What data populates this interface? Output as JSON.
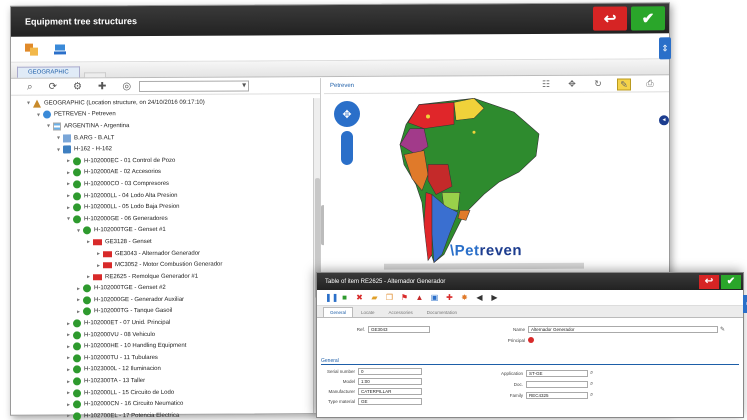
{
  "window": {
    "title": "Equipment tree structures",
    "back_glyph": "↩",
    "confirm_glyph": "✔"
  },
  "tabs": [
    "GEOGRAPHIC",
    "                    "
  ],
  "tree": [
    {
      "level": 0,
      "icon": "root",
      "label": "GEOGRAPHIC (Location structure, on 24/10/2016 09:17:10)"
    },
    {
      "level": 1,
      "icon": "company",
      "label": "PETREVEN - Petreven"
    },
    {
      "level": 2,
      "icon": "flag",
      "label": "ARGENTINA - Argentina"
    },
    {
      "level": 3,
      "icon": "b",
      "label": "B.ARG - B.ALT"
    },
    {
      "level": 3,
      "icon": "h",
      "label": "H-162 - H-162"
    },
    {
      "level": 4,
      "icon": "gdot",
      "label": "H-102000EC - 01 Control de Pozo"
    },
    {
      "level": 4,
      "icon": "gdot",
      "label": "H-102000AE - 02 Accesorios"
    },
    {
      "level": 4,
      "icon": "gdot",
      "label": "H-102000CO - 03 Compresores"
    },
    {
      "level": 4,
      "icon": "gdot",
      "label": "H-102000LL - 04 Lodo Alta Presion"
    },
    {
      "level": 4,
      "icon": "gdot",
      "label": "H-102000LL - 05 Lodo Baja Presion"
    },
    {
      "level": 4,
      "icon": "gdot",
      "label": "H-102000GE - 06 Generadores"
    },
    {
      "level": 5,
      "icon": "gdot",
      "label": "H-102000TGE - Genset #1"
    },
    {
      "level": 6,
      "icon": "rsq",
      "label": "GE3128 - Genset"
    },
    {
      "level": 7,
      "icon": "rsq",
      "label": "GE3043 - Alternador Generador"
    },
    {
      "level": 7,
      "icon": "rsq",
      "label": "MC3052 - Motor Combustion Generador"
    },
    {
      "level": 6,
      "icon": "rsq",
      "label": "RE2625 - Remolque Generador #1"
    },
    {
      "level": 5,
      "icon": "gdot",
      "label": "H-102000TGE - Genset #2"
    },
    {
      "level": 5,
      "icon": "gdot",
      "label": "H-102000GE - Generador Auxiliar"
    },
    {
      "level": 5,
      "icon": "gdot",
      "label": "H-102000TG - Tanque Gasoil"
    },
    {
      "level": 4,
      "icon": "gdot",
      "label": "H-102000ET - 07 Unid. Principal"
    },
    {
      "level": 4,
      "icon": "gdot",
      "label": "H-102000VU - 08 Vehiculo"
    },
    {
      "level": 4,
      "icon": "gdot",
      "label": "H-102000HE - 10 Handling Equipment"
    },
    {
      "level": 4,
      "icon": "gdot",
      "label": "H-102000TU - 11 Tubulares"
    },
    {
      "level": 4,
      "icon": "gdot",
      "label": "H-1023000L - 12 Iluminacion"
    },
    {
      "level": 4,
      "icon": "gdot",
      "label": "H-102300TA - 13 Taller"
    },
    {
      "level": 4,
      "icon": "gdot",
      "label": "H-102000LL - 15 Circuito de Lodo"
    },
    {
      "level": 4,
      "icon": "gdot",
      "label": "H-102000CN - 16 Circuito Neumatico"
    },
    {
      "level": 4,
      "icon": "gdot",
      "label": "H-102700EL - 17 Potencia Electrica"
    },
    {
      "level": 4,
      "icon": "gdot",
      "label": "H-102000RE - 18 Remolque y Trailer"
    }
  ],
  "map": {
    "label": "Petreven",
    "watermark_a": "\\Pet",
    "watermark_b": "reven"
  },
  "dialog": {
    "title": "Table of item RE2625 - Alternador Generador",
    "tabs": [
      "General",
      "Locate",
      "Accessories",
      "Documentation"
    ],
    "fields": {
      "code_label": "Ref.",
      "code_value": "GE3043",
      "name_label": "Name",
      "name_value": "Alternador Generador",
      "program_label": "Principal",
      "section_title": "General",
      "serial_label": "Serial number",
      "serial_value": "0",
      "model_label": "Model",
      "model_value": "1:00",
      "manufacturer_label": "Manufacturer",
      "manufacturer_value": "CATERPILLAR",
      "type_label": "Type material",
      "type_value": "GE",
      "app_label": "Application",
      "app_value": "ST-GE",
      "doc_label": "Doc.",
      "doc_value": "",
      "family_label": "Family",
      "family_value": "REC4325"
    }
  },
  "colors": {
    "titlebar": "#222222",
    "accent": "#2a6fc9",
    "red": "#d62424",
    "green": "#2aa62a"
  }
}
